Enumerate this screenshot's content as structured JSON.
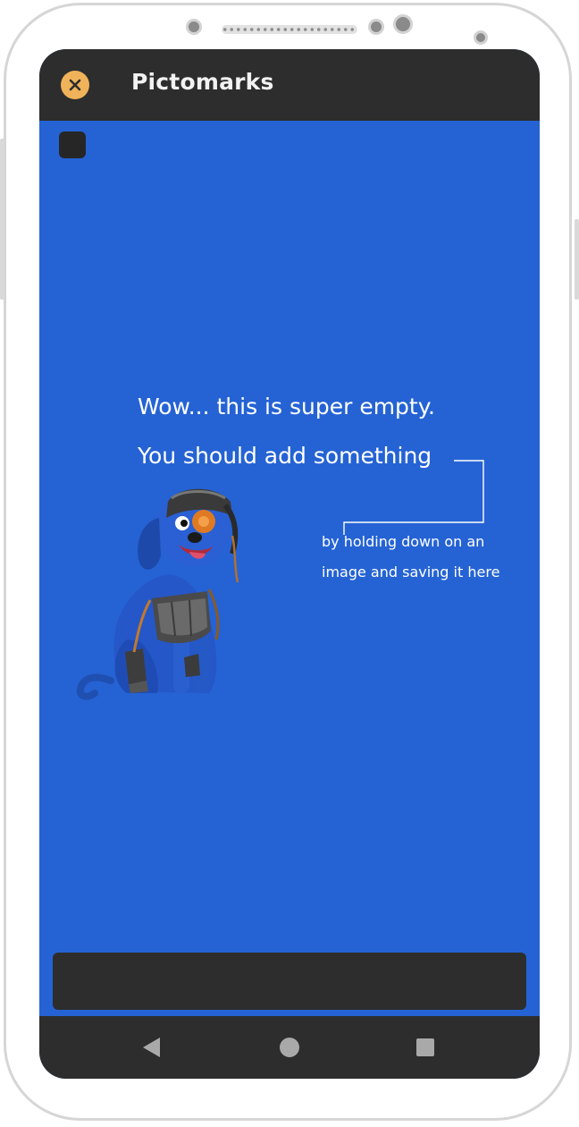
{
  "app": {
    "title": "Pictomarks"
  },
  "empty_state": {
    "headline_1": "Wow... this is super empty.",
    "headline_2": "You should add something",
    "hint": "by holding down on an image and saving it here"
  },
  "nav": {
    "back_icon": "triangle-back-icon",
    "home_icon": "circle-home-icon",
    "recents_icon": "square-recents-icon"
  },
  "colors": {
    "screen_bg": "#2563d4",
    "bar_bg": "#2d2d2d",
    "close_accent": "#f0b35a",
    "text": "#ffffff"
  }
}
